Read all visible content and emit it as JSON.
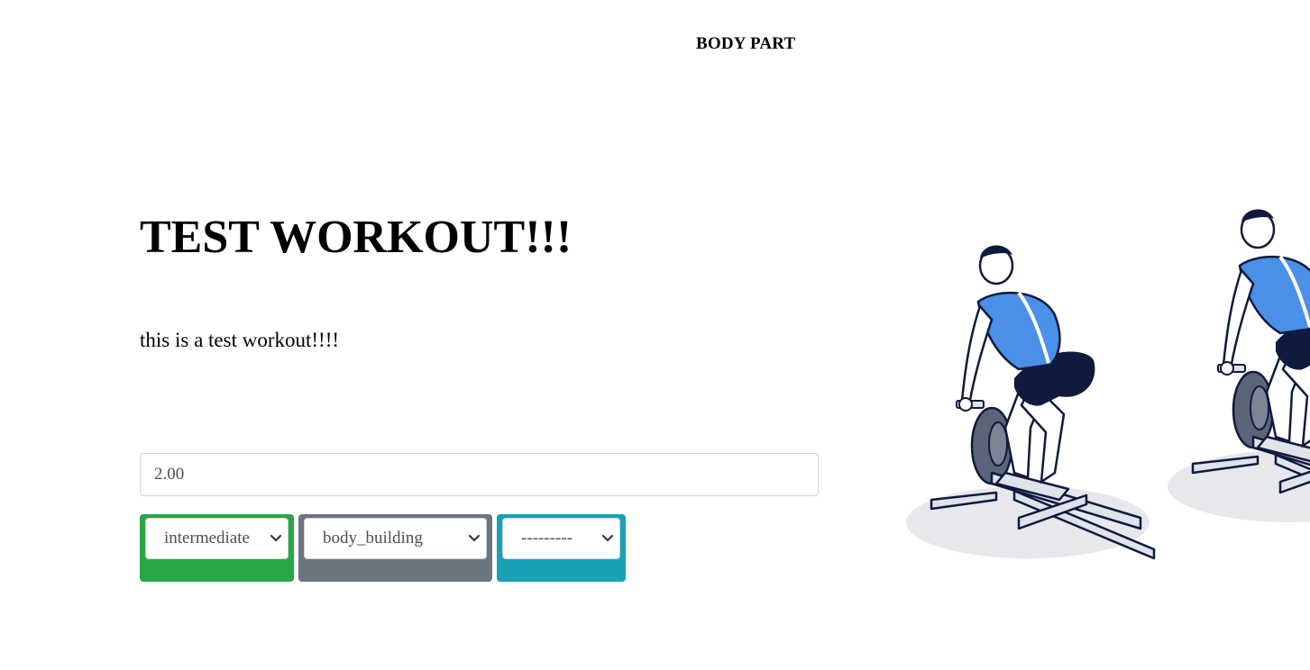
{
  "header": {
    "body_part_label": "BODY PART"
  },
  "workout": {
    "title": "TEST WORKOUT!!!",
    "description": "this is a test workout!!!!"
  },
  "form": {
    "value_input": "2.00",
    "selects": [
      {
        "selected": "intermediate",
        "color": "#28a745"
      },
      {
        "selected": "body_building",
        "color": "#6c757d"
      },
      {
        "selected": "---------",
        "color": "#17a2b8"
      }
    ]
  },
  "illustration": {
    "icon": "deadlift-exercise-illustration",
    "colors": {
      "shirt": "#4a8fe8",
      "shorts": "#0f1a3d",
      "floor": "#e6e8ec"
    }
  }
}
